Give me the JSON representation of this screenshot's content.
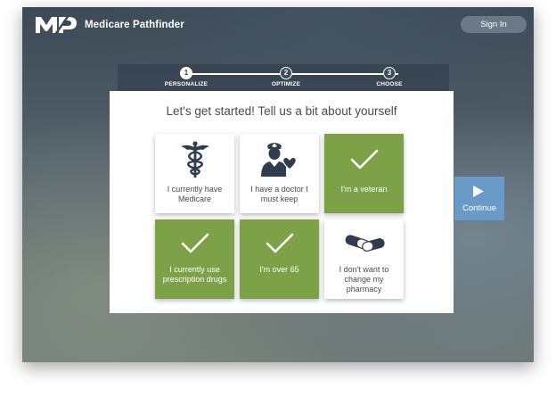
{
  "header": {
    "brand_name": "Medicare Pathfinder",
    "sign_in_label": "Sign In"
  },
  "stepper": {
    "steps": [
      {
        "number": "1",
        "label": "PERSONALIZE",
        "state": "active"
      },
      {
        "number": "2",
        "label": "OPTIMIZE",
        "state": "todo"
      },
      {
        "number": "3",
        "label": "CHOOSE",
        "state": "todo"
      }
    ]
  },
  "main": {
    "heading": "Let's get started! Tell us a bit about yourself",
    "tiles": [
      {
        "text": "I currently have Medicare",
        "icon": "caduceus-icon",
        "selected": false
      },
      {
        "text": "I have a doctor I must keep",
        "icon": "doctor-heart-icon",
        "selected": false
      },
      {
        "text": "I'm a veteran",
        "icon": "checkmark-icon",
        "selected": true
      },
      {
        "text": "I currently use prescription drugs",
        "icon": "checkmark-icon",
        "selected": true
      },
      {
        "text": "I'm over 65",
        "icon": "checkmark-icon",
        "selected": true
      },
      {
        "text": "I don't want to change my pharmacy",
        "icon": "pills-icon",
        "selected": false
      }
    ]
  },
  "continue": {
    "label": "Continue",
    "icon": "play-triangle-icon"
  },
  "colors": {
    "selected_tile": "#7ca146",
    "continue_button": "#6a9ac8",
    "icon_navy": "#2f3e4f",
    "heading_text": "#4a4a4a"
  }
}
